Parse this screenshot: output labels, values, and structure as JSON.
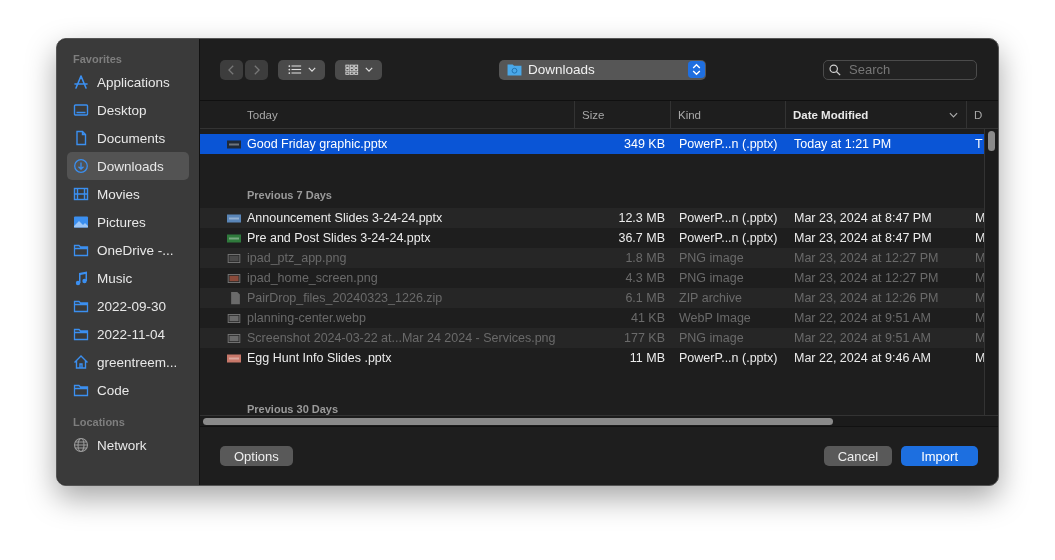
{
  "sidebar": {
    "sections": [
      {
        "title": "Favorites",
        "items": [
          {
            "label": "Applications",
            "kind": "apps",
            "selected": false
          },
          {
            "label": "Desktop",
            "kind": "desktop",
            "selected": false
          },
          {
            "label": "Documents",
            "kind": "document",
            "selected": false
          },
          {
            "label": "Downloads",
            "kind": "download",
            "selected": true
          },
          {
            "label": "Movies",
            "kind": "film",
            "selected": false
          },
          {
            "label": "Pictures",
            "kind": "photo",
            "selected": false
          },
          {
            "label": "OneDrive -...",
            "kind": "folder",
            "selected": false
          },
          {
            "label": "Music",
            "kind": "music",
            "selected": false
          },
          {
            "label": "2022-09-30",
            "kind": "folder",
            "selected": false
          },
          {
            "label": "2022-11-04",
            "kind": "folder",
            "selected": false
          },
          {
            "label": "greentreem...",
            "kind": "home",
            "selected": false
          },
          {
            "label": "Code",
            "kind": "folder",
            "selected": false
          }
        ]
      },
      {
        "title": "Locations",
        "items": [
          {
            "label": "Network",
            "kind": "globe",
            "selected": false
          }
        ]
      }
    ]
  },
  "toolbar": {
    "back_disabled": true,
    "forward_disabled": true,
    "location": "Downloads",
    "search": {
      "placeholder": "Search"
    }
  },
  "columns": [
    {
      "label": "Today",
      "sorted": false
    },
    {
      "label": "Size",
      "sorted": false
    },
    {
      "label": "Kind",
      "sorted": false
    },
    {
      "label": "Date Modified",
      "sorted": true
    },
    {
      "label": "D",
      "sorted": false
    }
  ],
  "groups": [
    {
      "rows": [
        {
          "name": "Good Friday graphic.pptx",
          "size": "349 KB",
          "file_type": "PowerP...n (.pptx)",
          "date": "Today at 1:21 PM",
          "column_5": "T",
          "selected": true,
          "disabled": false,
          "kind": "slide",
          "color": "#1f2a3a"
        }
      ]
    },
    {
      "title": "Previous 7 Days",
      "rows": [
        {
          "name": "Announcement Slides 3-24-24.pptx",
          "size": "12.3 MB",
          "file_type": "PowerP...n (.pptx)",
          "date": "Mar 23, 2024 at 8:47 PM",
          "column_5": "M",
          "selected": false,
          "disabled": false,
          "kind": "slide",
          "color": "#5a86b8"
        },
        {
          "name": "Pre and Post Slides 3-24-24.pptx",
          "size": "36.7 MB",
          "file_type": "PowerP...n (.pptx)",
          "date": "Mar 23, 2024 at 8:47 PM",
          "column_5": "M",
          "selected": false,
          "disabled": false,
          "kind": "slide",
          "color": "#2f7a3c"
        },
        {
          "name": "ipad_ptz_app.png",
          "size": "1.8 MB",
          "file_type": "PNG image",
          "date": "Mar 23, 2024 at 12:27 PM",
          "column_5": "M",
          "selected": false,
          "disabled": true,
          "kind": "image",
          "color": "#4a4a4a"
        },
        {
          "name": "ipad_home_screen.png",
          "size": "4.3 MB",
          "file_type": "PNG image",
          "date": "Mar 23, 2024 at 12:27 PM",
          "column_5": "M",
          "selected": false,
          "disabled": true,
          "kind": "image",
          "color": "#8a4a3a"
        },
        {
          "name": "PairDrop_files_20240323_1226.zip",
          "size": "6.1 MB",
          "file_type": "ZIP archive",
          "date": "Mar 23, 2024 at 12:26 PM",
          "column_5": "M",
          "selected": false,
          "disabled": true,
          "kind": "document",
          "color": "#6a6a6a"
        },
        {
          "name": "planning-center.webp",
          "size": "41 KB",
          "file_type": "WebP Image",
          "date": "Mar 22, 2024 at 9:51 AM",
          "column_5": "M",
          "selected": false,
          "disabled": true,
          "kind": "image",
          "color": "#6a6a6a"
        },
        {
          "name": "Screenshot 2024-03-22 at...Mar 24 2024 - Services.png",
          "size": "177 KB",
          "file_type": "PNG image",
          "date": "Mar 22, 2024 at 9:51 AM",
          "column_5": "M",
          "selected": false,
          "disabled": true,
          "kind": "image",
          "color": "#6a6a6a"
        },
        {
          "name": "Egg Hunt Info Slides .pptx",
          "size": "11 MB",
          "file_type": "PowerP...n (.pptx)",
          "date": "Mar 22, 2024 at 9:46 AM",
          "column_5": "M",
          "selected": false,
          "disabled": false,
          "kind": "slide",
          "color": "#c8786a"
        }
      ]
    },
    {
      "title": "Previous 30 Days"
    }
  ],
  "buttons": [
    {
      "label": "Options",
      "kind": "plain"
    },
    {
      "label": "Cancel",
      "kind": "plain"
    },
    {
      "label": "Import",
      "kind": "primary"
    }
  ]
}
